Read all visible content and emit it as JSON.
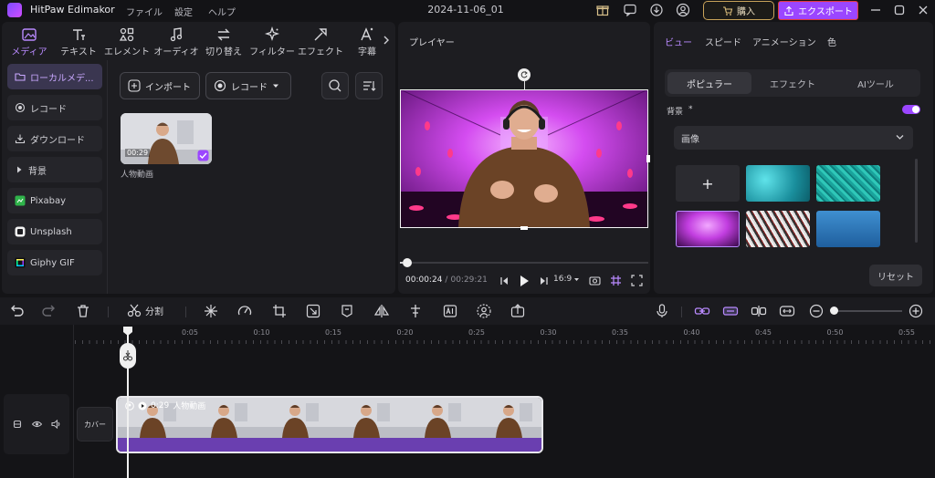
{
  "titlebar": {
    "app_name": "HitPaw Edimakor",
    "menus": [
      "ファイル",
      "設定",
      "ヘルプ"
    ],
    "project_title": "2024-11-06_01",
    "buy_label": "購入",
    "export_label": "エクスポート"
  },
  "left": {
    "categories": [
      "メディア",
      "テキスト",
      "エレメント",
      "オーディオ",
      "切り替え",
      "フィルター",
      "エフェクト",
      "字幕"
    ],
    "sidebar": [
      "ローカルメデ...",
      "レコード",
      "ダウンロード",
      "背景",
      "Pixabay",
      "Unsplash",
      "Giphy GIF"
    ],
    "import_label": "インポート",
    "record_label": "レコード",
    "clip": {
      "duration": "00:29",
      "name": "人物動画"
    }
  },
  "player": {
    "title": "プレイヤー",
    "current_time": "00:00:24",
    "separator": "/",
    "total_time": "00:29:21",
    "ratio": "16:9",
    "progress": 0.01
  },
  "right": {
    "tabs": [
      "ビュー",
      "スピード",
      "アニメーション",
      "色"
    ],
    "subtabs": [
      "ポピュラー",
      "エフェクト",
      "AIツール"
    ],
    "section_label": "背景",
    "select_value": "画像",
    "add_symbol": "+",
    "reset_label": "リセット"
  },
  "toolbar": {
    "split_label": "分割"
  },
  "timeline": {
    "ticks": [
      "0:05",
      "0:10",
      "0:15",
      "0:20",
      "0:25",
      "0:30",
      "0:35",
      "0:40",
      "0:45",
      "0:50",
      "0:55"
    ],
    "cover_label": "カバー",
    "clip_duration": "0:29",
    "clip_name": "人物動画"
  },
  "colors": {
    "accent": "#9b46ff",
    "highlight": "#b98aff",
    "clip_bar": "#6a3fb0"
  }
}
